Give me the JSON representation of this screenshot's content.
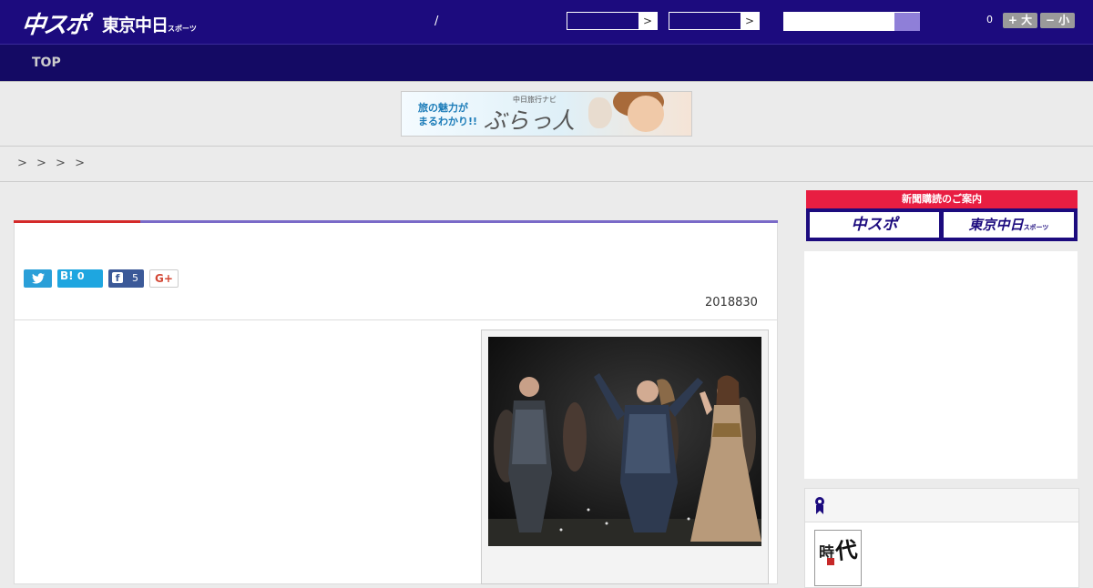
{
  "header": {
    "logo_main": "中スポ",
    "logo_sub": "東京中日",
    "logo_sub_small": "スポーツ",
    "separator": "/",
    "select_arrow": ">",
    "counter": "0",
    "font_larger": "+ 大",
    "font_smaller": "− 小"
  },
  "nav": {
    "top_label": "TOP"
  },
  "ad_banner": {
    "line1": "旅の魅力が",
    "line2": "まるわかり!!",
    "brand_small": "中日旅行ナビ",
    "brand": "ぶらっ人"
  },
  "breadcrumb": {
    "text": "> >   > >"
  },
  "article": {
    "date": "2018830",
    "share": {
      "hatena_label": "B!",
      "hatena_count": "0",
      "facebook_count": "5",
      "gplus_label": "G+"
    }
  },
  "sidebar": {
    "subscribe_title": "新聞購読のご案内",
    "subscribe_btn1": "中スポ",
    "subscribe_btn2": "東京中日",
    "subscribe_btn2_small": "スポーツ",
    "book_title_a": "時",
    "book_title_b": "代"
  },
  "colors": {
    "header_bg": "#1c0b7e",
    "nav_bg": "#140a64",
    "accent_red": "#d42a2a",
    "accent_purple": "#7a6ac8",
    "subscribe_red": "#e81e42"
  }
}
